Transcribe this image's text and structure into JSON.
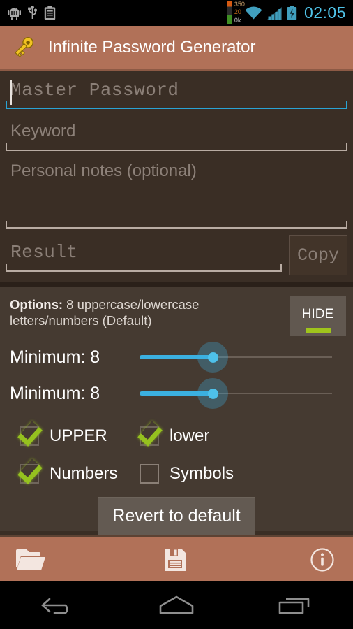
{
  "status_bar": {
    "icons": [
      "android-debug-icon",
      "usb-icon",
      "clipboard-icon"
    ],
    "monitor": {
      "top": "350",
      "middle": "20",
      "bottom": "0k"
    },
    "wifi_icon": "wifi-icon",
    "signal_icon": "cellular-signal-icon",
    "battery_icon": "battery-charging-icon",
    "clock": "02:05"
  },
  "app_bar": {
    "icon": "key-icon",
    "title": "Infinite Password Generator"
  },
  "form": {
    "master_password": {
      "value": "",
      "placeholder": "Master Password",
      "focused": true
    },
    "keyword": {
      "value": "",
      "placeholder": "Keyword"
    },
    "notes": {
      "value": "",
      "placeholder": "Personal notes (optional)"
    },
    "result": {
      "value": "",
      "placeholder": "Result"
    },
    "copy_label": "Copy"
  },
  "options": {
    "label": "Options:",
    "summary": " 8 uppercase/lowercase letters/numbers (Default)",
    "hide_label": "HIDE",
    "accent_color": "#9fc41c",
    "sliders": [
      {
        "label": "Minimum: 8",
        "value": 8,
        "percent": 38
      },
      {
        "label": "Minimum: 8",
        "value": 8,
        "percent": 38
      }
    ],
    "checkboxes": [
      {
        "label": "UPPER",
        "checked": true
      },
      {
        "label": "lower",
        "checked": true
      },
      {
        "label": "Numbers",
        "checked": true
      },
      {
        "label": "Symbols",
        "checked": false
      }
    ],
    "revert_label": "Revert to default"
  },
  "action_bar": {
    "items": [
      "open-folder-icon",
      "save-floppy-icon",
      "info-icon"
    ]
  },
  "nav_bar": {
    "items": [
      "back-icon",
      "home-icon",
      "recent-apps-icon"
    ]
  },
  "colors": {
    "app_bar": "#b17158",
    "background": "#3a2e25",
    "options_panel": "#453a31",
    "accent_blue": "#33b5e5",
    "accent_green": "#9fc41c",
    "clock_blue": "#4fc3e8"
  }
}
